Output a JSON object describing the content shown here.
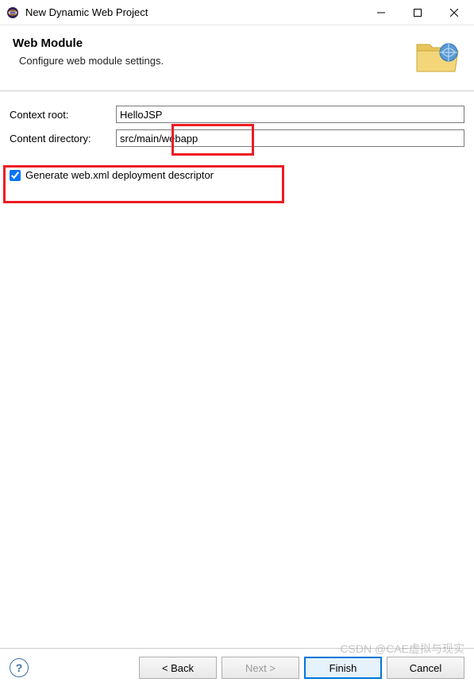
{
  "titlebar": {
    "title": "New Dynamic Web Project"
  },
  "header": {
    "title": "Web Module",
    "subtitle": "Configure web module settings."
  },
  "form": {
    "context_root_label": "Context root:",
    "context_root_value": "HelloJSP",
    "content_dir_label": "Content directory:",
    "content_dir_value": "src/main/webapp",
    "generate_webxml_label": "Generate web.xml deployment descriptor",
    "generate_webxml_checked": true
  },
  "footer": {
    "back": "< Back",
    "next": "Next >",
    "finish": "Finish",
    "cancel": "Cancel"
  },
  "watermark": "CSDN @CAE虚拟与现实"
}
